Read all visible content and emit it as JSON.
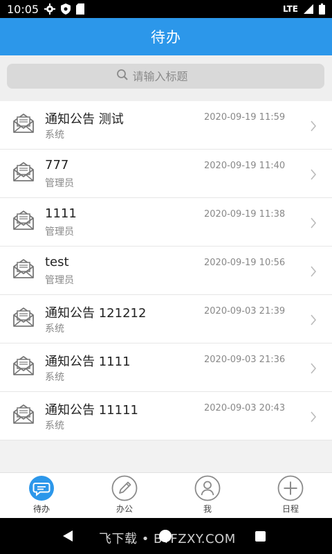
{
  "status_bar": {
    "time": "10:05",
    "left_icons": [
      "gear-icon",
      "shield-icon",
      "sd-card-icon"
    ],
    "network": "LTE",
    "right_icons": [
      "signal-icon",
      "battery-icon"
    ]
  },
  "header": {
    "title": "待办"
  },
  "search": {
    "placeholder": "请输入标题"
  },
  "items": [
    {
      "title": "通知公告 测试",
      "sender": "系统",
      "time": "2020-09-19 11:59"
    },
    {
      "title": "777",
      "sender": "管理员",
      "time": "2020-09-19 11:40"
    },
    {
      "title": "1111",
      "sender": "管理员",
      "time": "2020-09-19 11:38"
    },
    {
      "title": "test",
      "sender": "管理员",
      "time": "2020-09-19 10:56"
    },
    {
      "title": "通知公告 121212",
      "sender": "系统",
      "time": "2020-09-03 21:39"
    },
    {
      "title": "通知公告 1111",
      "sender": "系统",
      "time": "2020-09-03 21:36"
    },
    {
      "title": "通知公告 11111",
      "sender": "系统",
      "time": "2020-09-03 20:43"
    }
  ],
  "tabs": [
    {
      "label": "待办",
      "icon": "chat-bubble-icon",
      "active": true
    },
    {
      "label": "办公",
      "icon": "pencil-icon",
      "active": false
    },
    {
      "label": "我",
      "icon": "person-icon",
      "active": false
    },
    {
      "label": "日程",
      "icon": "plus-icon",
      "active": false
    }
  ],
  "system_nav": {
    "watermark": "飞下载 • BTFZXY.COM"
  },
  "colors": {
    "accent": "#2c97ea",
    "active_tab": "#2c97ea",
    "icon_gray": "#8a8a8a"
  }
}
